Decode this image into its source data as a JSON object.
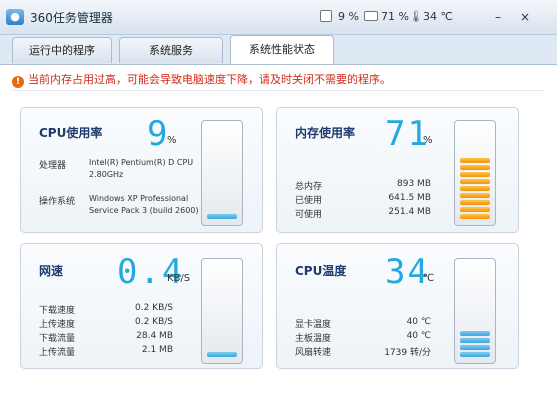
{
  "window": {
    "title": "360任务管理器",
    "status": {
      "cpu": "9 %",
      "mem": "71 %",
      "temp": "34 ℃"
    },
    "controls": {
      "minimize": "–",
      "close": "×"
    }
  },
  "tabs": [
    {
      "label": "运行中的程序",
      "active": false
    },
    {
      "label": "系统服务",
      "active": false
    },
    {
      "label": "系统性能状态",
      "active": true
    }
  ],
  "warning": "当前内存占用过高，可能会导致电脑速度下降，请及时关闭不需要的程序。",
  "cpu": {
    "title": "CPU使用率",
    "value": "9",
    "unit": "%",
    "processor_label": "处理器",
    "processor_value_1": "Intel(R) Pentium(R) D CPU",
    "processor_value_2": "2.80GHz",
    "os_label": "操作系统",
    "os_value_1": "Windows XP Professional",
    "os_value_2": "Service Pack 3 (build 2600)",
    "level": 0.09
  },
  "memory": {
    "title": "内存使用率",
    "value": "71",
    "unit": "%",
    "rows": [
      {
        "label": "总内存",
        "value": "893 MB"
      },
      {
        "label": "已使用",
        "value": "641.5 MB"
      },
      {
        "label": "可使用",
        "value": "251.4 MB"
      }
    ],
    "level": 0.71
  },
  "network": {
    "title": "网速",
    "value": "0.4",
    "unit": "KB/S",
    "rows": [
      {
        "label": "下载速度",
        "value": "0.2 KB/S"
      },
      {
        "label": "上传速度",
        "value": "0.2 KB/S"
      },
      {
        "label": "下载流量",
        "value": "28.4 MB"
      },
      {
        "label": "上传流量",
        "value": "2.1 MB"
      }
    ],
    "level": 0.05
  },
  "temperature": {
    "title": "CPU温度",
    "value": "34",
    "unit": "℃",
    "rows": [
      {
        "label": "显卡温度",
        "value": "40 ℃"
      },
      {
        "label": "主板温度",
        "value": "40 ℃"
      },
      {
        "label": "风扇转速",
        "value": "1739 转/分"
      }
    ],
    "level": 0.34
  },
  "colors": {
    "digit": "#23a9de",
    "title": "#1f3b6e",
    "warning": "#d12b1a",
    "meter_low": "#3fa5de",
    "meter_high": "#f0920b"
  }
}
